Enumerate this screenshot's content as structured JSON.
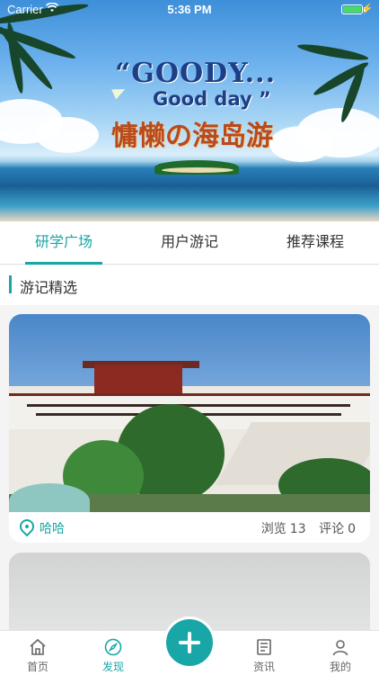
{
  "status_bar": {
    "carrier": "Carrier",
    "time": "5:36 PM",
    "battery_level": 1.0
  },
  "banner": {
    "line1": "“GOODY...",
    "line2": "Good day ”",
    "line3": "慵懒の海岛游"
  },
  "tabs": [
    {
      "label": "研学广场",
      "active": true
    },
    {
      "label": "用户游记",
      "active": false
    },
    {
      "label": "推荐课程",
      "active": false
    }
  ],
  "section": {
    "title": "游记精选"
  },
  "cards": [
    {
      "author": "哈哈",
      "views_label": "浏览",
      "views": "13",
      "comments_label": "评论",
      "comments": "0"
    }
  ],
  "tabbar": {
    "items": [
      {
        "label": "首页",
        "icon": "home-icon",
        "active": false
      },
      {
        "label": "发现",
        "icon": "compass-icon",
        "active": true
      },
      {
        "label": "资讯",
        "icon": "news-icon",
        "active": false
      },
      {
        "label": "我的",
        "icon": "user-icon",
        "active": false
      }
    ],
    "fab_icon": "plus-icon"
  },
  "colors": {
    "accent": "#18a6a6"
  }
}
